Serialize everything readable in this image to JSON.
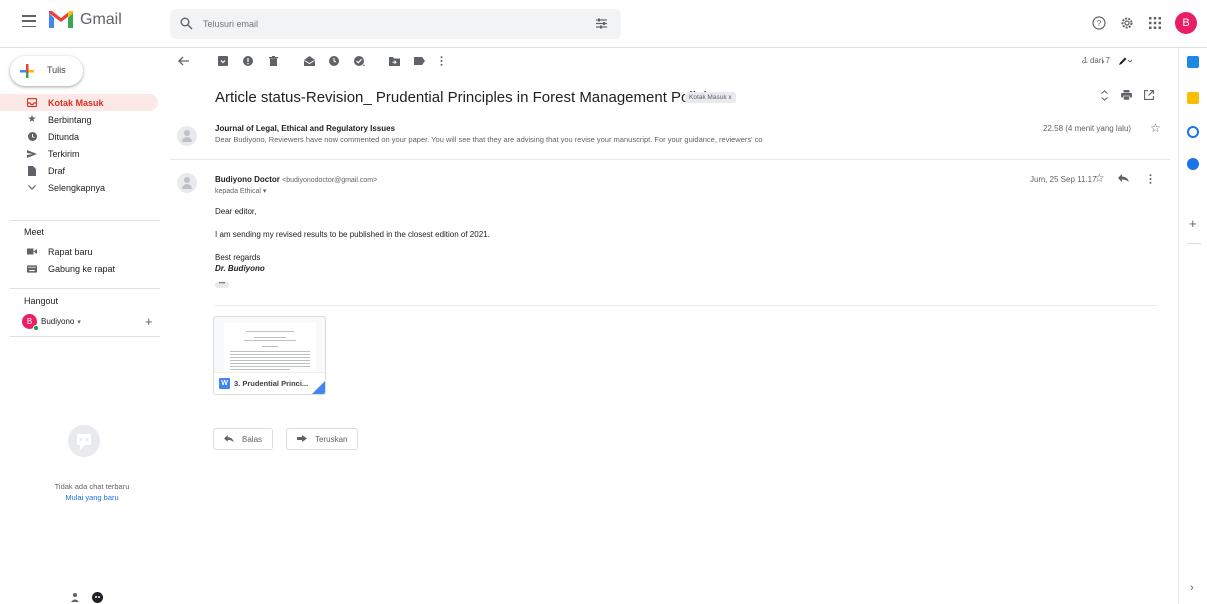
{
  "header": {
    "app_name": "Gmail",
    "search_placeholder": "Telusuri email",
    "avatar_letter": "B"
  },
  "sidebar": {
    "compose_label": "Tulis",
    "items": [
      {
        "label": "Kotak Masuk",
        "icon": "inbox-icon",
        "active": true
      },
      {
        "label": "Berbintang",
        "icon": "star-icon"
      },
      {
        "label": "Ditunda",
        "icon": "clock-icon"
      },
      {
        "label": "Terkirim",
        "icon": "send-icon"
      },
      {
        "label": "Draf",
        "icon": "draft-icon"
      },
      {
        "label": "Selengkapnya",
        "icon": "chevron-down-icon"
      }
    ],
    "meet_title": "Meet",
    "meet_items": [
      {
        "label": "Rapat baru",
        "icon": "video-icon"
      },
      {
        "label": "Gabung ke rapat",
        "icon": "keyboard-icon"
      }
    ],
    "hangout_title": "Hangout",
    "hangout_user": "Budiyono",
    "hangout_avatar": "B",
    "no_chat": "Tidak ada chat terbaru",
    "start_chat": "Mulai yang baru"
  },
  "toolbar": {
    "pager": "1 dari 7"
  },
  "thread": {
    "subject": "Article status-Revision_ Prudential Principles in Forest Management Policies",
    "label_chip": "Kotak Masuk x",
    "messages": [
      {
        "from": "Journal of Legal, Ethical and Regulatory Issues",
        "snippet": "Dear Budiyono, Reviewers have now commented on your paper. You will see that they are advising that you revise your manuscript. For your guidance, reviewers' co",
        "time": "22.58 (4 menit yang lalu)"
      },
      {
        "from": "Budiyono Doctor",
        "email": "<budiyonodoctor@gmail.com>",
        "to": "kepada Ethical ▾",
        "time": "Jum, 25 Sep 11.17",
        "greeting": "Dear editor,",
        "body": "I am sending my revised results to be published in the closest edition of 2021.",
        "closing": "Best regards",
        "signature": "Dr. Budiyono",
        "more": "•••"
      }
    ],
    "attachment": {
      "name": "3. Prudential Princi...",
      "icon_letter": "W"
    },
    "reply_label": "Balas",
    "forward_label": "Teruskan"
  },
  "colors": {
    "accent_red": "#d93025",
    "active_bg": "#fce8e6",
    "link_blue": "#1a73e8",
    "avatar_pink": "#e91e63"
  }
}
